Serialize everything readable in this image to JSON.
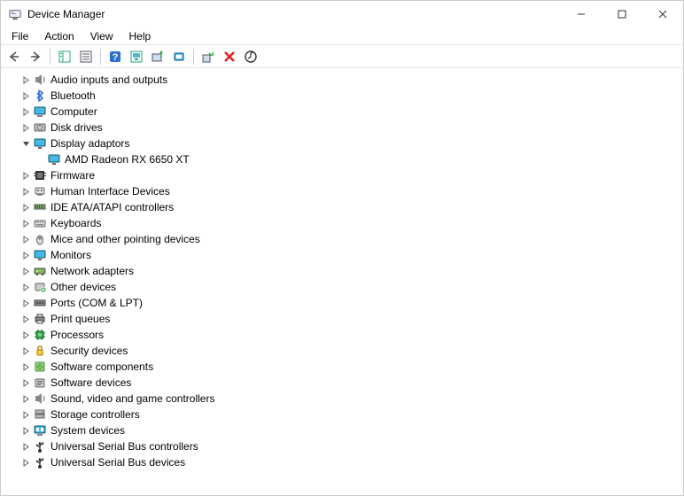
{
  "window": {
    "title": "Device Manager"
  },
  "menu": {
    "file": "File",
    "action": "Action",
    "view": "View",
    "help": "Help"
  },
  "tree": {
    "items": [
      {
        "label": "Audio inputs and outputs",
        "expanded": false,
        "icon": "audio"
      },
      {
        "label": "Bluetooth",
        "expanded": false,
        "icon": "bluetooth"
      },
      {
        "label": "Computer",
        "expanded": false,
        "icon": "computer"
      },
      {
        "label": "Disk drives",
        "expanded": false,
        "icon": "disk"
      },
      {
        "label": "Display adaptors",
        "expanded": true,
        "icon": "display",
        "children": [
          {
            "label": "AMD Radeon RX 6650 XT",
            "icon": "display"
          }
        ]
      },
      {
        "label": "Firmware",
        "expanded": false,
        "icon": "firmware"
      },
      {
        "label": "Human Interface Devices",
        "expanded": false,
        "icon": "hid"
      },
      {
        "label": "IDE ATA/ATAPI controllers",
        "expanded": false,
        "icon": "ide"
      },
      {
        "label": "Keyboards",
        "expanded": false,
        "icon": "keyboard"
      },
      {
        "label": "Mice and other pointing devices",
        "expanded": false,
        "icon": "mouse"
      },
      {
        "label": "Monitors",
        "expanded": false,
        "icon": "display"
      },
      {
        "label": "Network adapters",
        "expanded": false,
        "icon": "network"
      },
      {
        "label": "Other devices",
        "expanded": false,
        "icon": "other"
      },
      {
        "label": "Ports (COM & LPT)",
        "expanded": false,
        "icon": "port"
      },
      {
        "label": "Print queues",
        "expanded": false,
        "icon": "printer"
      },
      {
        "label": "Processors",
        "expanded": false,
        "icon": "cpu"
      },
      {
        "label": "Security devices",
        "expanded": false,
        "icon": "security"
      },
      {
        "label": "Software components",
        "expanded": false,
        "icon": "software"
      },
      {
        "label": "Software devices",
        "expanded": false,
        "icon": "softdevice"
      },
      {
        "label": "Sound, video and game controllers",
        "expanded": false,
        "icon": "audio"
      },
      {
        "label": "Storage controllers",
        "expanded": false,
        "icon": "storage"
      },
      {
        "label": "System devices",
        "expanded": false,
        "icon": "system"
      },
      {
        "label": "Universal Serial Bus controllers",
        "expanded": false,
        "icon": "usb"
      },
      {
        "label": "Universal Serial Bus devices",
        "expanded": false,
        "icon": "usb"
      }
    ]
  }
}
